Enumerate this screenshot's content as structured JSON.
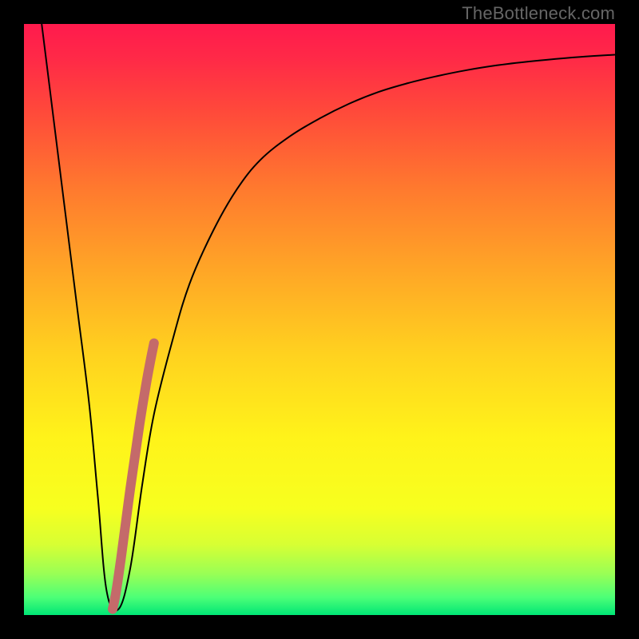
{
  "watermark": "TheBottleneck.com",
  "gradient": {
    "stops": [
      {
        "offset": 0.0,
        "color": "#ff1a4d"
      },
      {
        "offset": 0.06,
        "color": "#ff2a47"
      },
      {
        "offset": 0.15,
        "color": "#ff4a3a"
      },
      {
        "offset": 0.28,
        "color": "#ff7a2e"
      },
      {
        "offset": 0.42,
        "color": "#ffa726"
      },
      {
        "offset": 0.56,
        "color": "#ffd21f"
      },
      {
        "offset": 0.7,
        "color": "#fff31a"
      },
      {
        "offset": 0.82,
        "color": "#f7ff1f"
      },
      {
        "offset": 0.88,
        "color": "#d8ff33"
      },
      {
        "offset": 0.93,
        "color": "#99ff55"
      },
      {
        "offset": 0.97,
        "color": "#4dff77"
      },
      {
        "offset": 1.0,
        "color": "#00e676"
      }
    ]
  },
  "chart_data": {
    "type": "line",
    "title": "",
    "xlabel": "",
    "ylabel": "",
    "xlim": [
      0,
      100
    ],
    "ylim": [
      0,
      100
    ],
    "series": [
      {
        "name": "bottleneck-curve",
        "x": [
          3,
          5,
          7,
          9,
          11,
          12.5,
          14,
          16,
          18,
          20,
          22,
          25,
          28,
          32,
          36,
          40,
          45,
          50,
          55,
          60,
          65,
          70,
          75,
          80,
          85,
          90,
          95,
          100
        ],
        "y": [
          100,
          84,
          68,
          52,
          36,
          20,
          4,
          1,
          8,
          22,
          34,
          46,
          56,
          65,
          72,
          77,
          81,
          84,
          86.5,
          88.5,
          90,
          91.2,
          92.2,
          93,
          93.6,
          94.1,
          94.5,
          94.8
        ]
      },
      {
        "name": "highlight-segment",
        "x": [
          15.0,
          15.6,
          16.4,
          17.2,
          18.0,
          18.8,
          19.6,
          20.4,
          21.2,
          22.0
        ],
        "y": [
          1.0,
          4.0,
          9.5,
          15.5,
          21.5,
          27.0,
          32.5,
          37.5,
          42.0,
          46.0
        ]
      }
    ],
    "styles": {
      "bottleneck-curve": {
        "stroke": "#000000",
        "width": 2
      },
      "highlight-segment": {
        "stroke": "#c46a6a",
        "width": 12,
        "linecap": "round"
      }
    }
  }
}
